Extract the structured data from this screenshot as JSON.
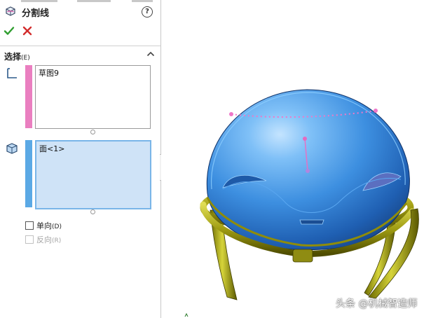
{
  "property_manager": {
    "title": "分割线",
    "sections": {
      "selection": {
        "title": "选择",
        "accelerator": "(E)",
        "sketch_list": {
          "items": [
            "草图9"
          ]
        },
        "face_list": {
          "items": [
            "面<1>"
          ]
        }
      }
    },
    "options": {
      "single_direction": {
        "label": "单向",
        "accelerator": "(D)",
        "checked": false
      },
      "reverse": {
        "label": "反向",
        "accelerator": "(R)",
        "checked": false,
        "enabled": false
      }
    }
  },
  "colors": {
    "sketch_accent": "#ea7fc0",
    "face_accent": "#5ba9e5",
    "ok_green": "#2f9e2f",
    "cancel_red": "#d22c2c",
    "face_selected_fill": "#cfe3f7"
  },
  "icons": [
    "split-line-feature-icon",
    "help-icon",
    "ok-check-icon",
    "cancel-x-icon",
    "collapse-chevron-icon",
    "sketch-selection-icon",
    "face-selection-icon"
  ],
  "watermark": "头条 @机械智造师"
}
